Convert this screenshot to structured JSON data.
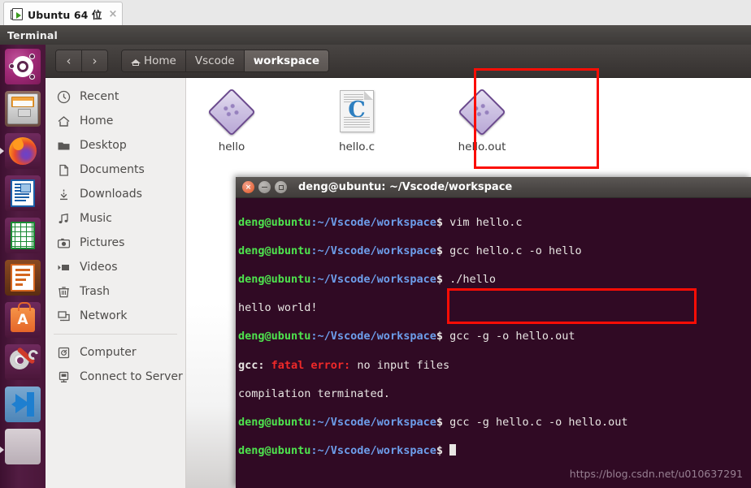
{
  "vm_tab": {
    "label": "Ubuntu 64 位",
    "close_label": "×",
    "icon": "vm-machine-icon"
  },
  "menubar": {
    "app_name": "Terminal"
  },
  "launcher": {
    "items": [
      {
        "name": "ubuntu-dash",
        "icon": "ubuntu-logo-icon"
      },
      {
        "name": "files",
        "icon": "file-cabinet-icon"
      },
      {
        "name": "firefox",
        "icon": "firefox-icon"
      },
      {
        "name": "libreoffice-writer",
        "icon": "document-icon"
      },
      {
        "name": "libreoffice-calc",
        "icon": "spreadsheet-icon"
      },
      {
        "name": "libreoffice-impress",
        "icon": "presentation-icon"
      },
      {
        "name": "ubuntu-software",
        "icon": "shopping-bag-a-icon"
      },
      {
        "name": "system-settings",
        "icon": "gear-wrench-icon"
      },
      {
        "name": "vscode",
        "icon": "vscode-icon"
      },
      {
        "name": "unknown-app",
        "icon": "blank-icon"
      }
    ]
  },
  "filemanager": {
    "nav": {
      "back_label": "‹",
      "forward_label": "›"
    },
    "breadcrumbs": [
      {
        "label": "Home",
        "icon": "home-icon",
        "active": false
      },
      {
        "label": "Vscode",
        "icon": "",
        "active": false
      },
      {
        "label": "workspace",
        "icon": "",
        "active": true
      }
    ],
    "sidebar": {
      "items": [
        {
          "label": "Recent",
          "icon": "clock-icon"
        },
        {
          "label": "Home",
          "icon": "home-icon"
        },
        {
          "label": "Desktop",
          "icon": "folder-icon"
        },
        {
          "label": "Documents",
          "icon": "document-icon"
        },
        {
          "label": "Downloads",
          "icon": "download-arrow-icon"
        },
        {
          "label": "Music",
          "icon": "music-note-icon"
        },
        {
          "label": "Pictures",
          "icon": "camera-icon"
        },
        {
          "label": "Videos",
          "icon": "video-play-icon"
        },
        {
          "label": "Trash",
          "icon": "trash-icon"
        },
        {
          "label": "Network",
          "icon": "network-icon"
        }
      ],
      "items_bottom": [
        {
          "label": "Computer",
          "icon": "computer-disk-icon"
        },
        {
          "label": "Connect to Server",
          "icon": "server-icon"
        }
      ]
    },
    "files": [
      {
        "name": "hello",
        "icon": "executable-diamond-icon",
        "highlighted": false
      },
      {
        "name": "hello.c",
        "icon": "c-source-file-icon",
        "highlighted": false
      },
      {
        "name": "hello.out",
        "icon": "executable-diamond-icon",
        "highlighted": true
      }
    ]
  },
  "terminal": {
    "title": "deng@ubuntu: ~/Vscode/workspace",
    "window_buttons": {
      "close": "×",
      "minimize": "–",
      "maximize": "□"
    },
    "prompt_user": "deng@ubuntu",
    "prompt_path": ":~/Vscode/workspace",
    "prompt_sigil": "$ ",
    "lines": [
      {
        "type": "prompt",
        "command": "vim hello.c"
      },
      {
        "type": "prompt",
        "command": "gcc hello.c -o hello"
      },
      {
        "type": "prompt",
        "command": "./hello"
      },
      {
        "type": "output",
        "text": "hello world!"
      },
      {
        "type": "prompt",
        "command": "gcc -g -o hello.out"
      },
      {
        "type": "error",
        "prefix": "gcc: ",
        "error": "fatal error: ",
        "text": "no input files"
      },
      {
        "type": "output",
        "text": "compilation terminated."
      },
      {
        "type": "prompt",
        "command": "gcc -g hello.c -o hello.out",
        "highlighted": true
      },
      {
        "type": "prompt",
        "command": "",
        "cursor": true
      }
    ]
  },
  "watermark": {
    "text": "https://blog.csdn.net/u010637291"
  },
  "colors": {
    "terminal_bg": "#300a24",
    "prompt_green": "#4ee44e",
    "prompt_blue": "#6d9eeb",
    "error_red": "#ef2929",
    "annotation_red": "#fb0d05",
    "launcher_purple": "#4a1639",
    "sidebar_bg": "#f0efee"
  }
}
